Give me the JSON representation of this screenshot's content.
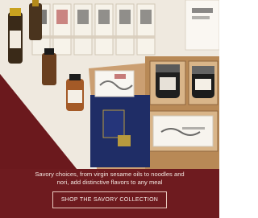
{
  "promo": {
    "tagline": "Savory choices, from virgin sesame oils to noodles and nori, add distinctive flavors to any meal",
    "cta_label": "SHOP THE SAVORY COLLECTION"
  },
  "colors": {
    "burgundy": "#6e1b1f",
    "wood": "#c79b6f",
    "navy": "#1e2f66",
    "cream": "#f4efe6"
  }
}
